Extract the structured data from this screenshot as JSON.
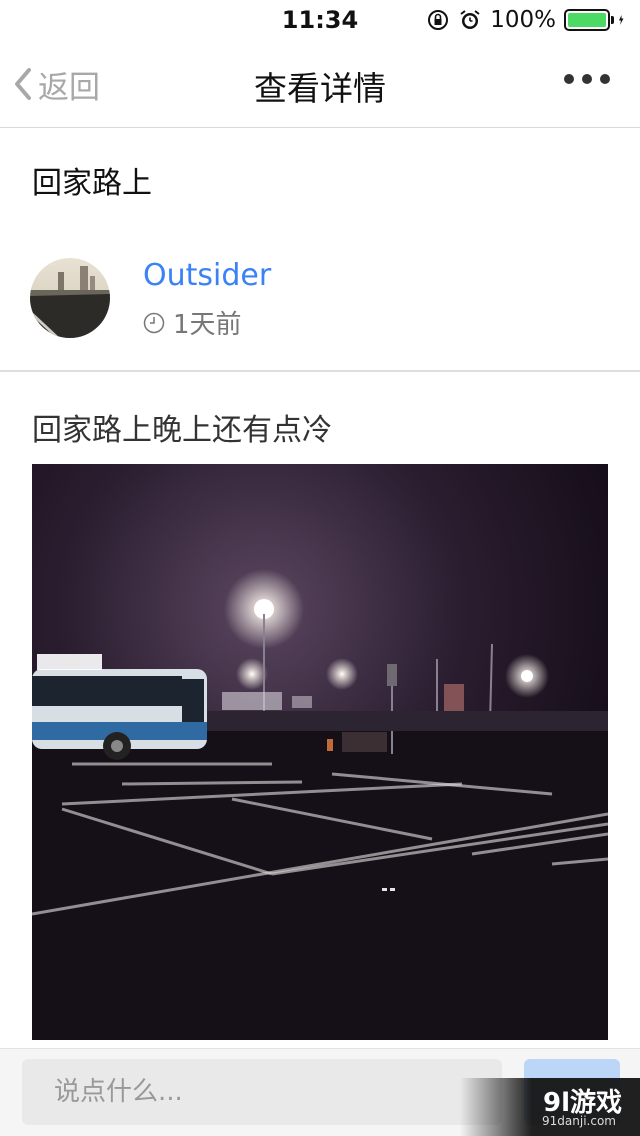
{
  "status_bar": {
    "time": "11:34",
    "battery_percent": "100%",
    "icons": [
      "rotation-lock-icon",
      "alarm-icon",
      "battery-icon",
      "charging-icon"
    ]
  },
  "nav": {
    "back_label": "返回",
    "title": "查看详情",
    "more_icon": "more-dots-icon"
  },
  "section_title": "回家路上",
  "author": {
    "name": "Outsider",
    "time": "1天前"
  },
  "post": {
    "text": "回家路上晚上还有点冷"
  },
  "comment": {
    "placeholder": "说点什么..."
  },
  "watermark": {
    "logo": "9l游戏",
    "url": "91danji.com"
  },
  "colors": {
    "accent": "#3b82f6",
    "send_button": "#bcd6f7",
    "battery": "#4cd964"
  }
}
